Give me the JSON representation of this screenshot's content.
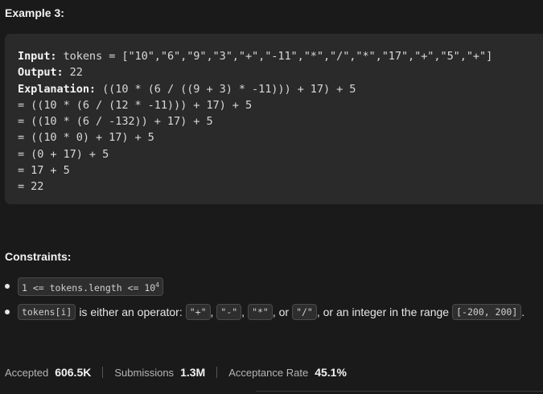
{
  "example": {
    "title": "Example 3:",
    "input_label": "Input:",
    "input_value": " tokens = [\"10\",\"6\",\"9\",\"3\",\"+\",\"-11\",\"*\",\"/\",\"*\",\"17\",\"+\",\"5\",\"+\"]",
    "output_label": "Output:",
    "output_value": " 22",
    "explanation_label": "Explanation:",
    "explanation_first": " ((10 * (6 / ((9 + 3) * -11))) + 17) + 5",
    "steps": [
      "= ((10 * (6 / (12 * -11))) + 17) + 5",
      "= ((10 * (6 / -132)) + 17) + 5",
      "= ((10 * 0) + 17) + 5",
      "= (0 + 17) + 5",
      "= 17 + 5",
      "= 22"
    ]
  },
  "constraints": {
    "title": "Constraints:",
    "item1": {
      "code": "1 <= tokens.length <= 10",
      "sup": "4"
    },
    "item2": {
      "code_var": "tokens[i]",
      "text1": "is either an operator:",
      "op_plus": "\"+\"",
      "comma1": ",",
      "op_minus": "\"-\"",
      "comma2": ",",
      "op_times": "\"*\"",
      "text_or": ", or",
      "op_div": "\"/\"",
      "text2": ", or an integer in the range",
      "range": "[-200, 200]",
      "period": "."
    }
  },
  "stats": {
    "accepted_label": "Accepted",
    "accepted_value": "606.5K",
    "submissions_label": "Submissions",
    "submissions_value": "1.3M",
    "rate_label": "Acceptance Rate",
    "rate_value": "45.1%"
  }
}
